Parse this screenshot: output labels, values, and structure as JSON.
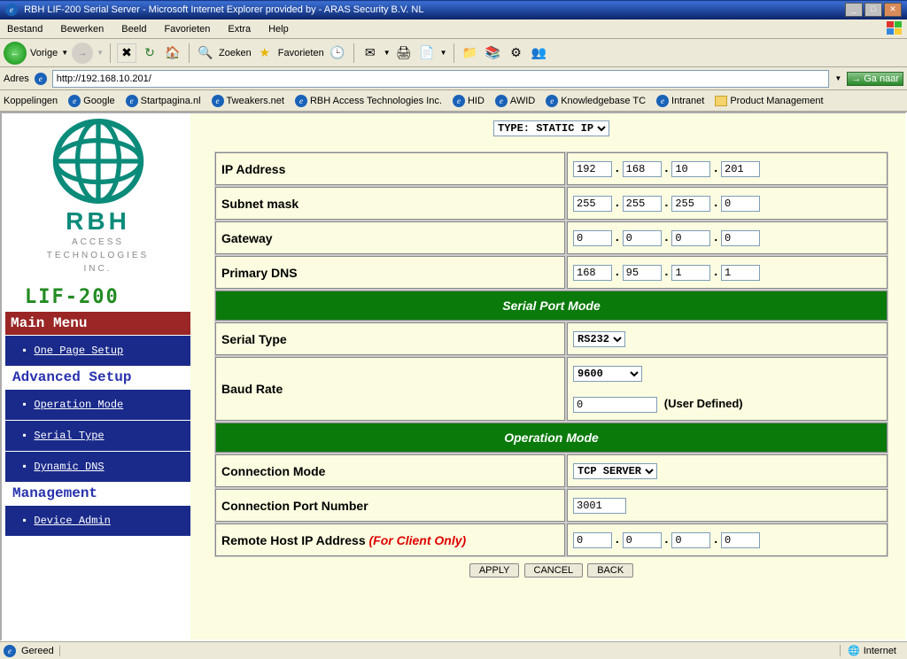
{
  "window": {
    "title": "RBH LIF-200 Serial Server - Microsoft Internet Explorer provided by - ARAS Security B.V. NL"
  },
  "menu": [
    "Bestand",
    "Bewerken",
    "Beeld",
    "Favorieten",
    "Extra",
    "Help"
  ],
  "toolbar": {
    "back": "Vorige",
    "search": "Zoeken",
    "fav": "Favorieten"
  },
  "addr": {
    "label": "Adres",
    "url": "http://192.168.10.201/",
    "go": "Ga naar"
  },
  "links": {
    "label": "Koppelingen",
    "items": [
      "Google",
      "Startpagina.nl",
      "Tweakers.net",
      "RBH Access Technologies Inc.",
      "HID",
      "AWID",
      "Knowledgebase TC",
      "Intranet",
      "Product Management"
    ]
  },
  "brand": {
    "rbh": "RBH",
    "sub1": "ACCESS",
    "sub2": "TECHNOLOGIES",
    "sub3": "INC.",
    "model": "LIF-200"
  },
  "nav": {
    "main": "Main Menu",
    "one_page": "One Page Setup",
    "adv": "Advanced Setup",
    "op": "Operation Mode",
    "serial": "Serial Type",
    "ddns": "Dynamic DNS",
    "mgmt": "Management",
    "devadm": "Device Admin"
  },
  "form": {
    "type_sel": "TYPE: STATIC IP",
    "ip_label": "IP Address",
    "ip": [
      "192",
      "168",
      "10",
      "201"
    ],
    "sn_label": "Subnet mask",
    "sn": [
      "255",
      "255",
      "255",
      "0"
    ],
    "gw_label": "Gateway",
    "gw": [
      "0",
      "0",
      "0",
      "0"
    ],
    "dns_label": "Primary DNS",
    "dns": [
      "168",
      "95",
      "1",
      "1"
    ],
    "sec1": "Serial Port Mode",
    "st_label": "Serial Type",
    "st": "RS232",
    "br_label": "Baud Rate",
    "br": "9600",
    "br_ud": "0",
    "br_ud_lbl": "(User Defined)",
    "sec2": "Operation Mode",
    "cm_label": "Connection Mode",
    "cm": "TCP SERVER",
    "cpn_label": "Connection Port Number",
    "cpn": "3001",
    "rh_label": "Remote Host IP Address ",
    "rh_note": "(For Client Only)",
    "rh": [
      "0",
      "0",
      "0",
      "0"
    ],
    "apply": "APPLY",
    "cancel": "CANCEL",
    "back": "BACK"
  },
  "status": {
    "ready": "Gereed",
    "zone": "Internet"
  }
}
